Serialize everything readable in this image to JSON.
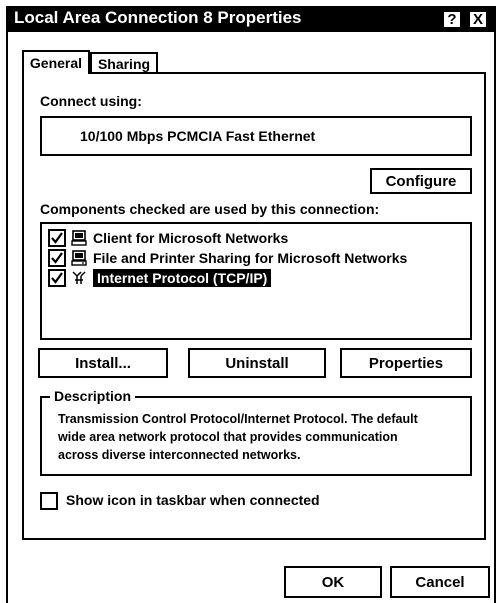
{
  "window": {
    "title": "Local Area Connection 8 Properties",
    "help_label": "?",
    "close_label": "X"
  },
  "tabs": [
    {
      "label": "General",
      "selected": true
    },
    {
      "label": "Sharing",
      "selected": false
    }
  ],
  "general": {
    "connect_using_label": "Connect using:",
    "adapter_name": "10/100 Mbps PCMCIA Fast Ethernet",
    "configure_label": "Configure",
    "components_label": "Components checked are used by this connection:",
    "components": [
      {
        "label": "Client for Microsoft Networks",
        "checked": true,
        "icon": "network-client-icon"
      },
      {
        "label": "File and Printer Sharing for Microsoft Networks",
        "checked": true,
        "icon": "network-service-icon"
      },
      {
        "label": "Internet Protocol (TCP/IP)",
        "checked": true,
        "icon": "network-protocol-icon",
        "selected": true
      }
    ],
    "install_label": "Install...",
    "uninstall_label": "Uninstall",
    "properties_label": "Properties",
    "description_label": "Description",
    "description_lines": [
      "Transmission Control Protocol/Internet Protocol. The default",
      "wide area network protocol that provides communication",
      "across diverse interconnected networks."
    ],
    "show_icon_label": "Show icon in taskbar when connected",
    "show_icon_checked": false
  },
  "footer": {
    "ok_label": "OK",
    "cancel_label": "Cancel"
  }
}
